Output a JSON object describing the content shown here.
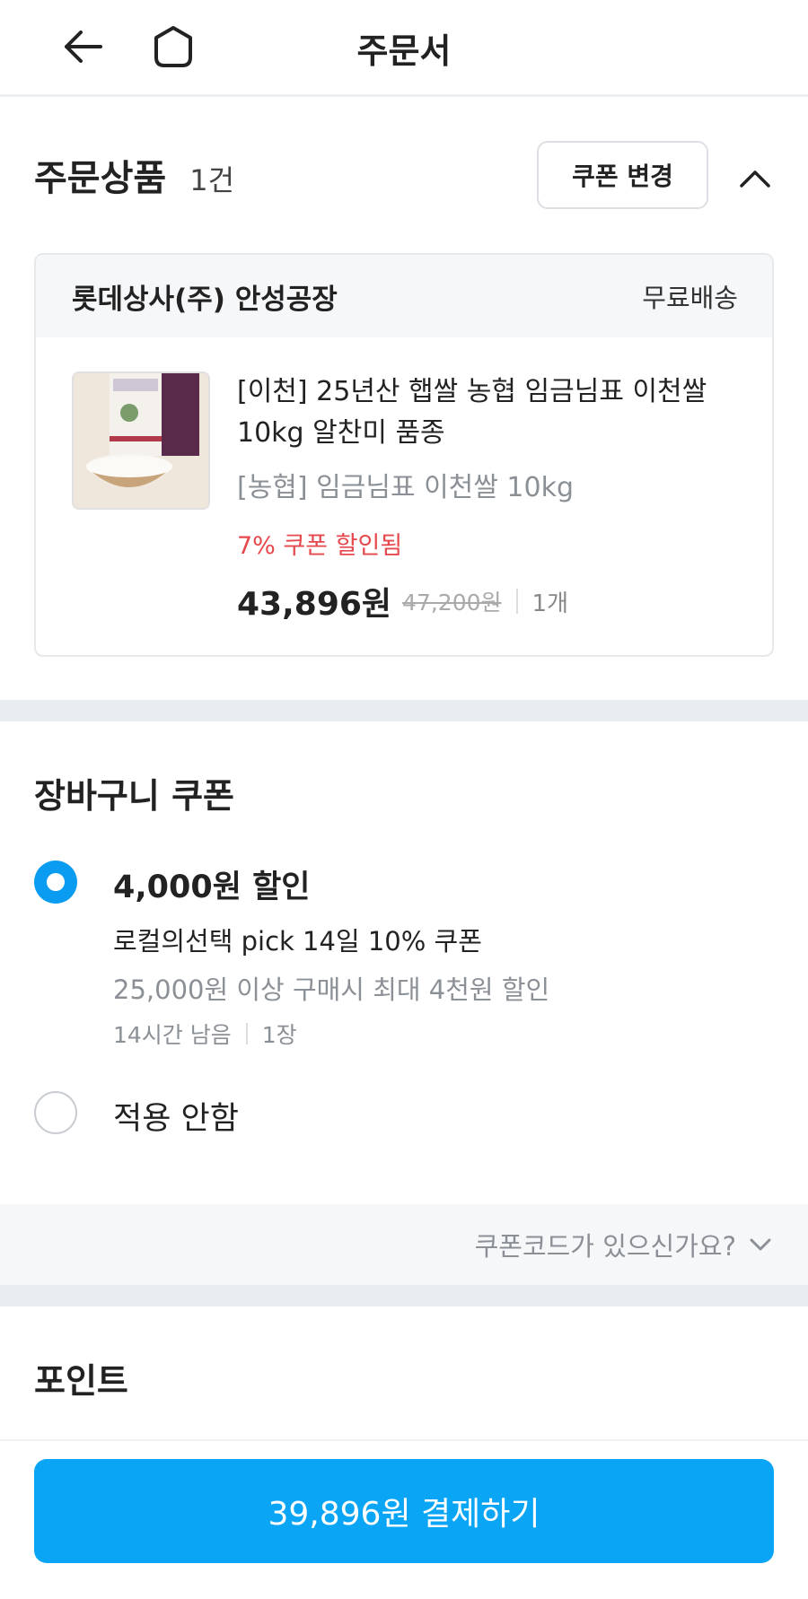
{
  "header": {
    "title": "주문서",
    "back_icon": "back-arrow-icon",
    "home_icon": "home-icon"
  },
  "order_products": {
    "title": "주문상품",
    "count": "1건",
    "coupon_change_label": "쿠폰 변경",
    "collapse_icon": "chevron-up-icon",
    "seller": "롯데상사(주) 안성공장",
    "shipping": "무료배송",
    "item": {
      "name": "[이천] 25년산 햅쌀 농협 임금님표 이천쌀 10kg 알찬미 품종",
      "option": "[농협] 임금님표 이천쌀 10kg",
      "coupon_note": "7% 쿠폰 할인됨",
      "price": "43,896원",
      "original_price": "47,200원",
      "quantity": "1개"
    }
  },
  "cart_coupon": {
    "title": "장바구니 쿠폰",
    "options": [
      {
        "discount": "4,000원 할인",
        "name": "로컬의선택 pick 14일 10% 쿠폰",
        "condition": "25,000원 이상 구매시 최대 4천원 할인",
        "time_left": "14시간 남음",
        "count": "1장",
        "selected": true
      },
      {
        "label": "적용 안함",
        "selected": false
      }
    ],
    "coupon_code_prompt": "쿠폰코드가 있으신가요?"
  },
  "points": {
    "title": "포인트"
  },
  "footer": {
    "pay_button_label": "39,896원 결제하기"
  },
  "colors": {
    "accent": "#0aa5f5",
    "radio_selected": "#0a9cf0",
    "coupon_red": "#e5484d",
    "muted_text": "#8b9096"
  }
}
